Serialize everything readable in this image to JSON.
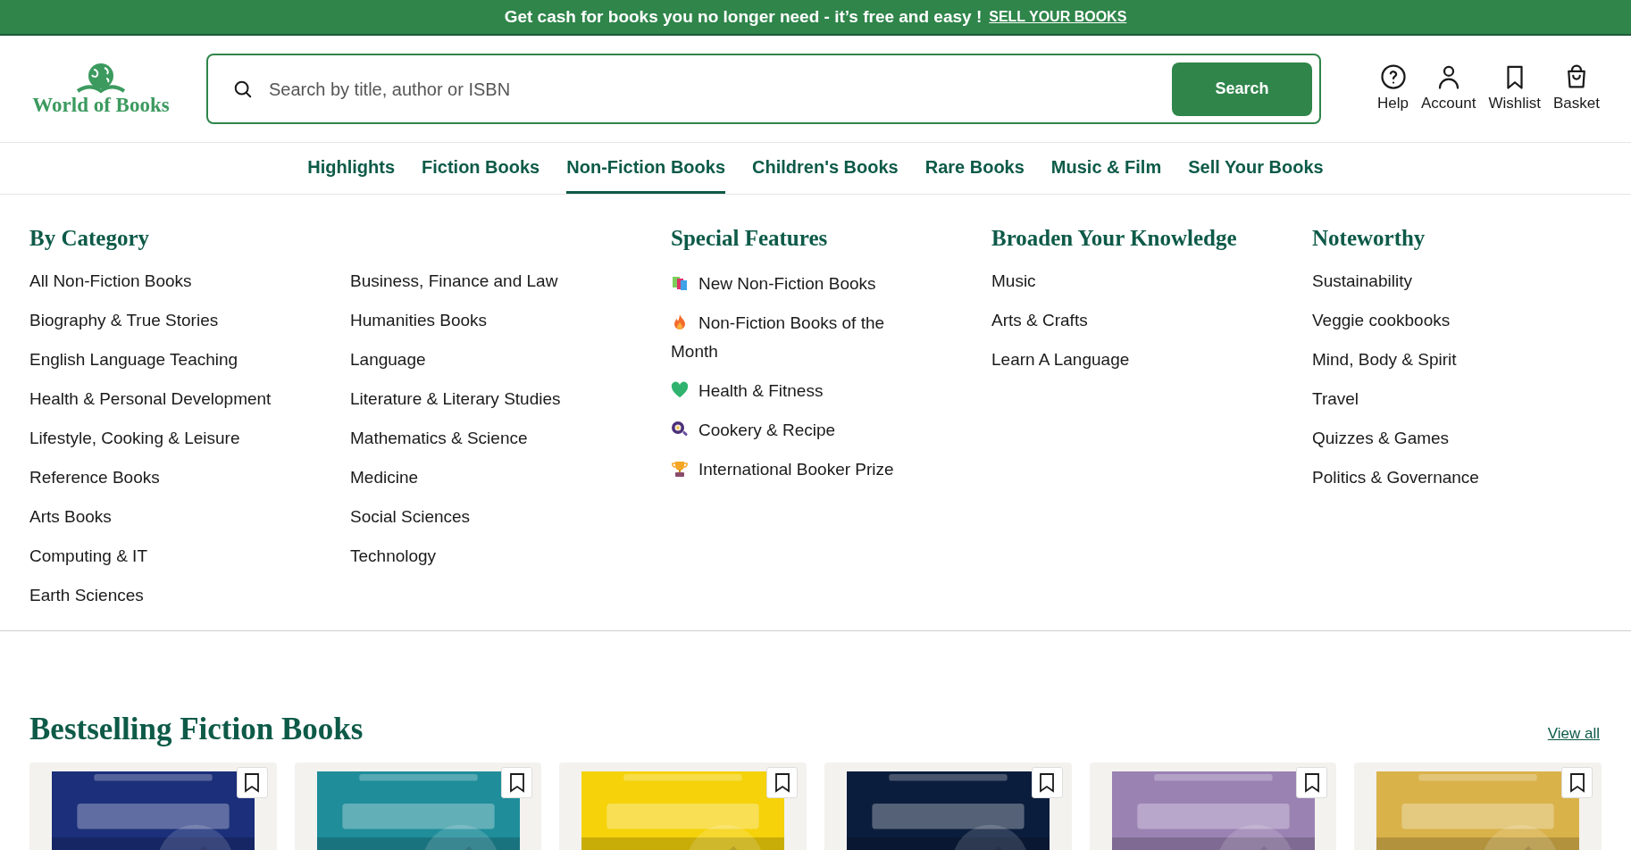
{
  "banner": {
    "text": "Get cash for books you no longer need - it’s free and easy !",
    "link": "SELL YOUR BOOKS"
  },
  "logo": {
    "text": "World of Books"
  },
  "search": {
    "placeholder": "Search by title, author or ISBN",
    "button": "Search"
  },
  "header_actions": [
    {
      "label": "Help"
    },
    {
      "label": "Account"
    },
    {
      "label": "Wishlist"
    },
    {
      "label": "Basket"
    }
  ],
  "nav": [
    {
      "label": "Highlights",
      "selected": false
    },
    {
      "label": "Fiction Books",
      "selected": false
    },
    {
      "label": "Non-Fiction Books",
      "selected": true
    },
    {
      "label": "Children's Books",
      "selected": false
    },
    {
      "label": "Rare Books",
      "selected": false
    },
    {
      "label": "Music & Film",
      "selected": false
    },
    {
      "label": "Sell Your Books",
      "selected": false
    }
  ],
  "menu": {
    "by_category": {
      "title": "By Category",
      "column_1": [
        "All Non-Fiction Books",
        "Biography & True Stories",
        "English Language Teaching",
        "Health & Personal Development",
        "Lifestyle, Cooking & Leisure",
        "Reference Books",
        "Arts Books",
        "Computing & IT",
        "Earth Sciences"
      ],
      "column_2": [
        "Business, Finance and Law",
        "Humanities Books",
        "Language",
        "Literature & Literary Studies",
        "Mathematics & Science",
        "Medicine",
        "Social Sciences",
        "Technology"
      ]
    },
    "special_features": {
      "title": "Special Features",
      "items": [
        "New Non-Fiction Books",
        "Non-Fiction Books of the Month",
        "Health & Fitness",
        "Cookery & Recipe",
        "International Booker Prize"
      ]
    },
    "broaden": {
      "title": "Broaden Your Knowledge",
      "items": [
        "Music",
        "Arts & Crafts",
        "Learn A Language"
      ]
    },
    "noteworthy": {
      "title": "Noteworthy",
      "items": [
        "Sustainability",
        "Veggie cookbooks",
        "Mind, Body & Spirit",
        "Travel",
        "Quizzes & Games",
        "Politics & Governance"
      ]
    }
  },
  "bestselling": {
    "title": "Bestselling Fiction Books",
    "view_all": "View all"
  }
}
